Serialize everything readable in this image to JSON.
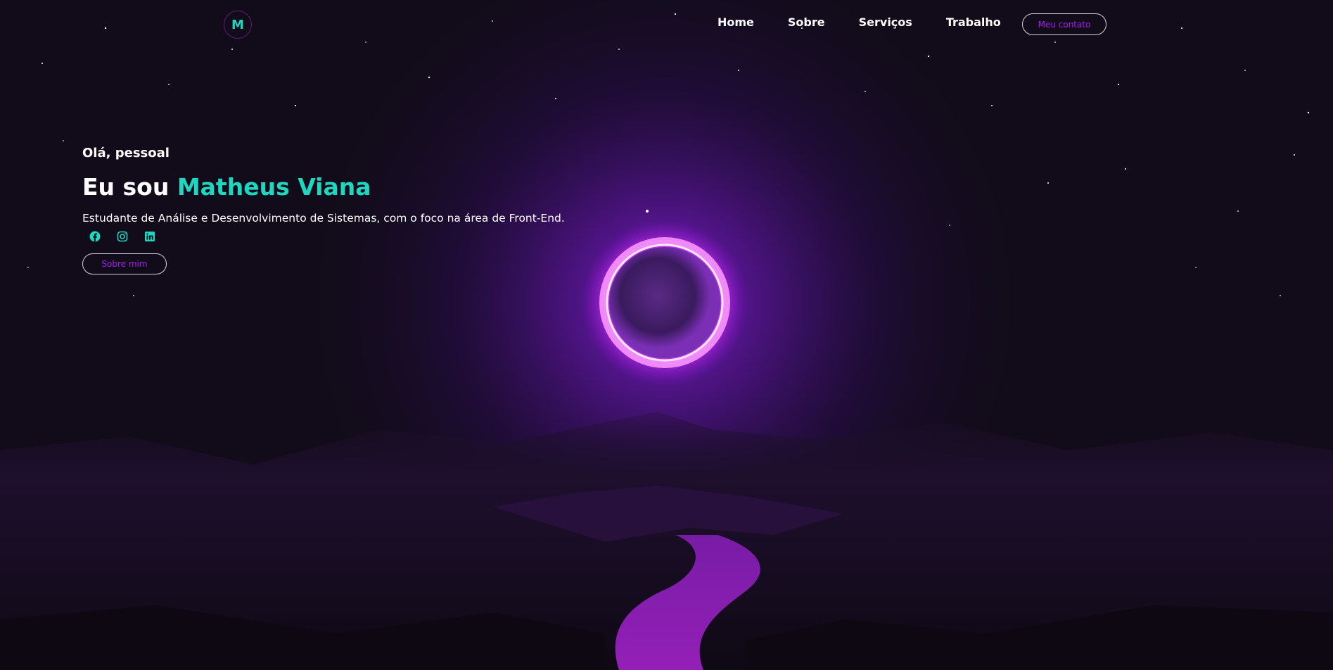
{
  "header": {
    "logo_letter": "M",
    "nav": [
      {
        "label": "Home"
      },
      {
        "label": "Sobre"
      },
      {
        "label": "Serviços"
      },
      {
        "label": "Trabalho"
      }
    ],
    "contact_button": "Meu contato"
  },
  "hero": {
    "greeting": "Olá, pessoal",
    "headline_prefix": "Eu sou ",
    "headline_name": "Matheus Viana",
    "subtitle": "Estudante de Análise e Desenvolvimento de Sistemas, com o foco na área de Front-End.",
    "socials": [
      {
        "icon": "facebook-icon"
      },
      {
        "icon": "instagram-icon"
      },
      {
        "icon": "linkedin-icon"
      }
    ],
    "about_button": "Sobre mim"
  },
  "colors": {
    "accent": "#1fd6c1",
    "button_text": "#a21ef0",
    "background": "#0f0b16",
    "glow": "#c026ff"
  }
}
